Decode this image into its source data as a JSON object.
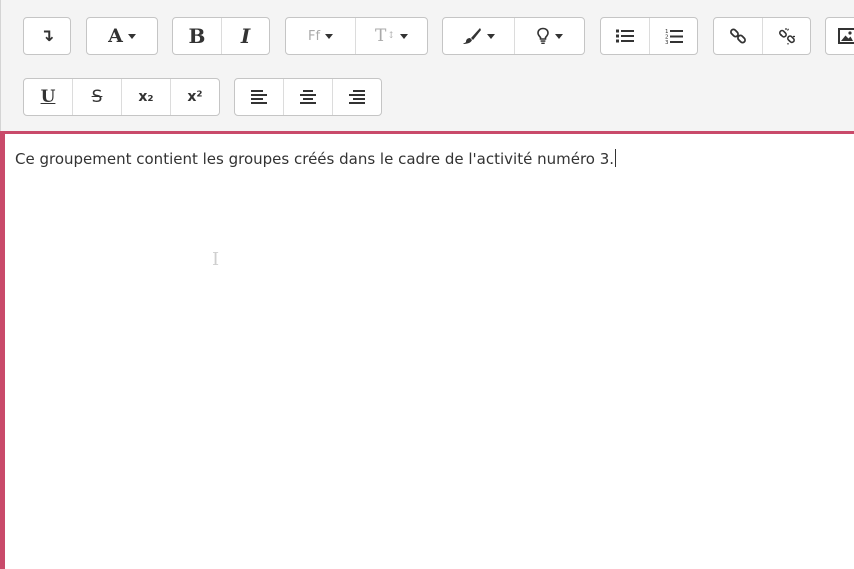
{
  "toolbar": {
    "row1": {
      "collapse_icon": "↴",
      "font_color_label": "A",
      "bold_label": "B",
      "italic_label": "I",
      "font_family_label": "Ff",
      "font_size_label": "T",
      "brush_icon": "paintbrush-icon",
      "hint_icon": "lightbulb-icon",
      "bullet_list_icon": "unordered-list-icon",
      "ordered_list_icon": "ordered-list-icon",
      "link_icon": "link-icon",
      "unlink_icon": "unlink-icon",
      "image_icon": "image-icon"
    },
    "row2": {
      "underline_label": "U",
      "strike_label": "S",
      "subscript_label": "x₂",
      "superscript_label": "x²",
      "align_left_icon": "align-left-icon",
      "align_center_icon": "align-center-icon",
      "align_right_icon": "align-right-icon"
    }
  },
  "content": {
    "text": "Ce groupement contient les groupes créés dans le cadre de l'activité numéro 3."
  },
  "colors": {
    "focus_border": "#c94a6a",
    "toolbar_bg": "#f4f4f4",
    "disabled_text": "#aaaaaa"
  }
}
